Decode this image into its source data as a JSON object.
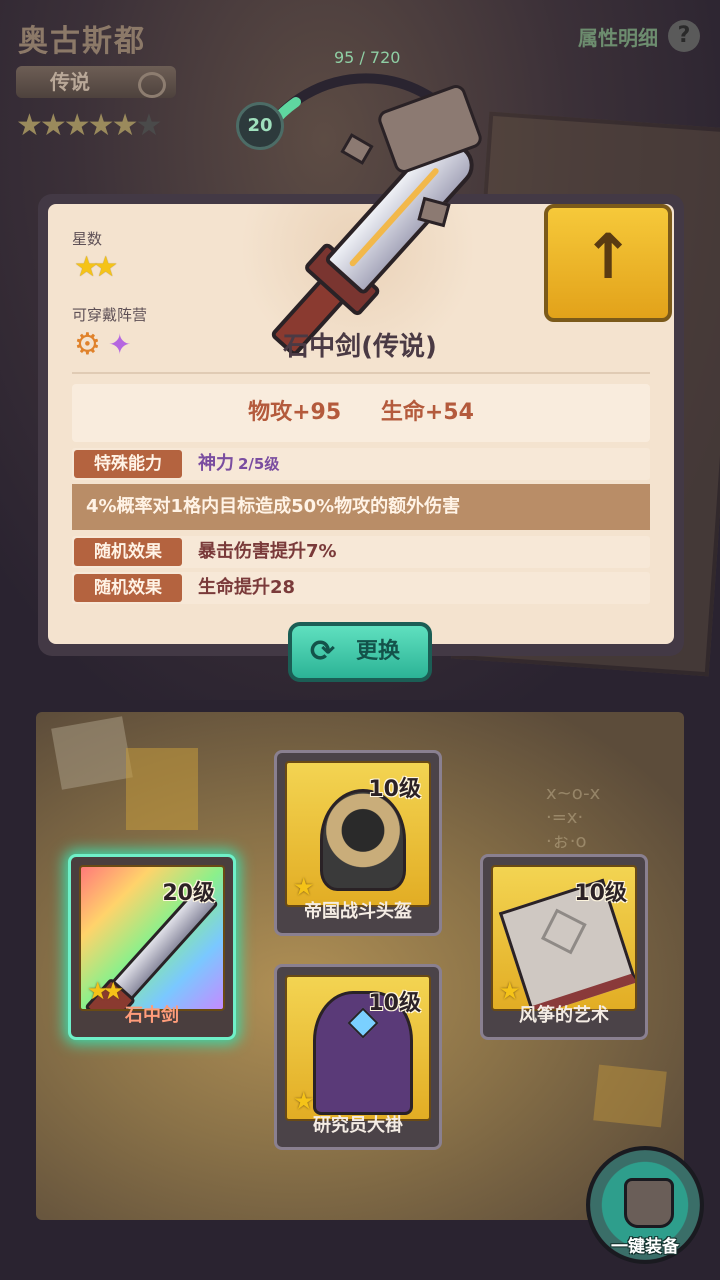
{
  "hero": {
    "name": "奥古斯都",
    "rarity": "传说",
    "stars": "★★★★★",
    "stars_dim": "★",
    "level": "20",
    "xp": "95 / 720",
    "attr_link": "属性明细",
    "help_icon": "?"
  },
  "item": {
    "star_label": "星数",
    "stars": "★★",
    "camp_label": "可穿戴阵营",
    "camp_icons": [
      "gear-icon",
      "fish-icon"
    ],
    "title": "石中剑(传说)",
    "stat_attack": "物攻+95",
    "stat_hp": "生命+54",
    "special_tag": "特殊能力",
    "special_name": "神力",
    "special_level": "2/5级",
    "special_desc": "4%概率对1格内目标造成50%物攻的额外伤害",
    "random1_tag": "随机效果",
    "random1_value": "暴击伤害提升7%",
    "random2_tag": "随机效果",
    "random2_value": "生命提升28",
    "swap_label": "更换",
    "upgrade_icon": "up-arrow-icon"
  },
  "slots": [
    {
      "name": "石中剑",
      "level": "20级",
      "stars": "★★",
      "icon": "sword-icon",
      "selected": true
    },
    {
      "name": "帝国战斗头盔",
      "level": "10级",
      "stars": "★",
      "icon": "helmet-icon"
    },
    {
      "name": "研究员大褂",
      "level": "10级",
      "stars": "★",
      "icon": "robe-icon"
    },
    {
      "name": "风筝的艺术",
      "level": "10级",
      "stars": "★",
      "icon": "book-icon"
    }
  ],
  "equip_all_label": "一键装备",
  "colors": {
    "accent_teal": "#2cb396",
    "card_gold": "#e2ad24",
    "tag_brown": "#b4633f",
    "attack_text": "#b45a3c"
  }
}
